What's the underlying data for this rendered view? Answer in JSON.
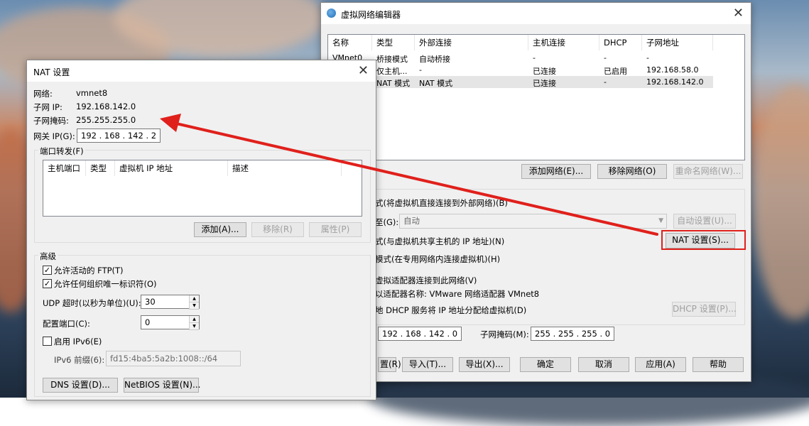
{
  "vne": {
    "title": "虚拟网络编辑器",
    "columns": [
      "名称",
      "类型",
      "外部连接",
      "主机连接",
      "DHCP",
      "子网地址"
    ],
    "rows": [
      {
        "name": "VMnet0",
        "type": "桥接模式",
        "ext": "自动桥接",
        "host": "-",
        "dhcp": "-",
        "subnet": "-"
      },
      {
        "name": "",
        "type": "仅主机...",
        "ext": "-",
        "host": "已连接",
        "dhcp": "已启用",
        "subnet": "192.168.58.0"
      },
      {
        "name": "",
        "type": "NAT 模式",
        "ext": "NAT 模式",
        "host": "已连接",
        "dhcp": "-",
        "subnet": "192.168.142.0"
      }
    ],
    "add_network": "添加网络(E)...",
    "remove_network": "移除网络(O)",
    "rename_network": "重命名网络(W)...",
    "bridge_desc": "式(将虚拟机直接连接到外部网络)(B)",
    "bridge_to_label": "至(G):",
    "bridge_to_value": "自动",
    "auto_settings": "自动设置(U)...",
    "nat_desc": "式(与虚拟机共享主机的 IP 地址)(N)",
    "nat_settings": "NAT 设置(S)...",
    "hostonly_desc": "模式(在专用网络内连接虚拟机)(H)",
    "connect_adapter": "虚拟适配器连接到此网络(V)",
    "adapter_name": "以适配器名称: VMware 网络适配器 VMnet8",
    "dhcp_desc": "地 DHCP 服务将 IP 地址分配给虚拟机(D)",
    "dhcp_settings": "DHCP 设置(P)...",
    "subnet_ip": "192 . 168 . 142 . 0",
    "mask_label": "子网掩码(M):",
    "mask_value": "255 . 255 . 255 . 0",
    "restore": "置(R)",
    "import": "导入(T)...",
    "export": "导出(X)...",
    "ok": "确定",
    "cancel": "取消",
    "apply": "应用(A)",
    "help": "帮助"
  },
  "nat": {
    "title": "NAT 设置",
    "network_label": "网络:",
    "network_value": "vmnet8",
    "subnet_ip_label": "子网 IP:",
    "subnet_ip_value": "192.168.142.0",
    "mask_label": "子网掩码:",
    "mask_value": "255.255.255.0",
    "gateway_label": "网关 IP(G):",
    "gateway_value": "192 . 168 . 142 . 2",
    "port_forward_label": "端口转发(F)",
    "pf_columns": [
      "主机端口",
      "类型",
      "虚拟机 IP 地址",
      "描述"
    ],
    "add": "添加(A)...",
    "remove": "移除(R)",
    "properties": "属性(P)",
    "advanced_label": "高级",
    "allow_ftp": "允许活动的 FTP(T)",
    "allow_oui": "允许任何组织唯一标识符(O)",
    "udp_label": "UDP 超时(以秒为单位)(U):",
    "udp_value": "30",
    "config_port_label": "配置端口(C):",
    "config_port_value": "0",
    "enable_ipv6": "启用 IPv6(E)",
    "ipv6_prefix_label": "IPv6 前缀(6):",
    "ipv6_prefix_value": "fd15:4ba5:5a2b:1008::/64",
    "dns_settings": "DNS 设置(D)...",
    "netbios_settings": "NetBIOS 设置(N)..."
  },
  "colors": {
    "annotation": "#e0201b"
  }
}
